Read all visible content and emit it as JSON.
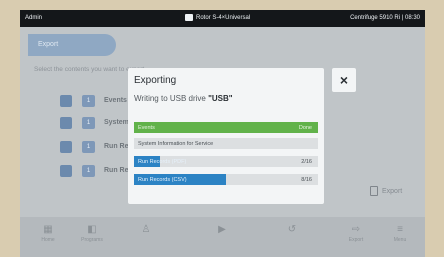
{
  "statusbar": {
    "user": "Admin",
    "rotor": "Rotor S-4×Universal",
    "device": "Centrifuge 5910 Ri | 08:30"
  },
  "tab": {
    "label": "Export"
  },
  "section": {
    "subtitle": "Select the contents you want to export"
  },
  "list": [
    {
      "num": "1",
      "label": "Events"
    },
    {
      "num": "1",
      "label": "System Information"
    },
    {
      "num": "1",
      "label": "Run Records (PDF)"
    },
    {
      "num": "1",
      "label": "Run Records (CSV)"
    }
  ],
  "side_export": {
    "label": "Export"
  },
  "toolbar": {
    "items": [
      {
        "glyph": "▦",
        "label": "Home"
      },
      {
        "glyph": "◧",
        "label": "Programs"
      },
      {
        "glyph": "♙",
        "label": ""
      },
      {
        "glyph": "▶",
        "label": ""
      },
      {
        "glyph": "↺",
        "label": ""
      },
      {
        "glyph": "⇨",
        "label": "Export"
      },
      {
        "glyph": "≡",
        "label": "Menu"
      }
    ]
  },
  "dialog": {
    "title": "Exporting",
    "message_prefix": "Writing to USB drive ",
    "drive": "\"USB\"",
    "close_glyph": "×",
    "items": [
      {
        "label": "Events",
        "count": "Done",
        "progress": 1.0,
        "state": "done"
      },
      {
        "label": "System Information for Service",
        "count": "",
        "progress": 0,
        "state": "pending"
      },
      {
        "label": "Run Records (PDF)",
        "count": "2/16",
        "progress": 0.14,
        "state": "progress"
      },
      {
        "label": "Run Records (CSV)",
        "count": "8/16",
        "progress": 0.5,
        "state": "progress"
      }
    ]
  }
}
